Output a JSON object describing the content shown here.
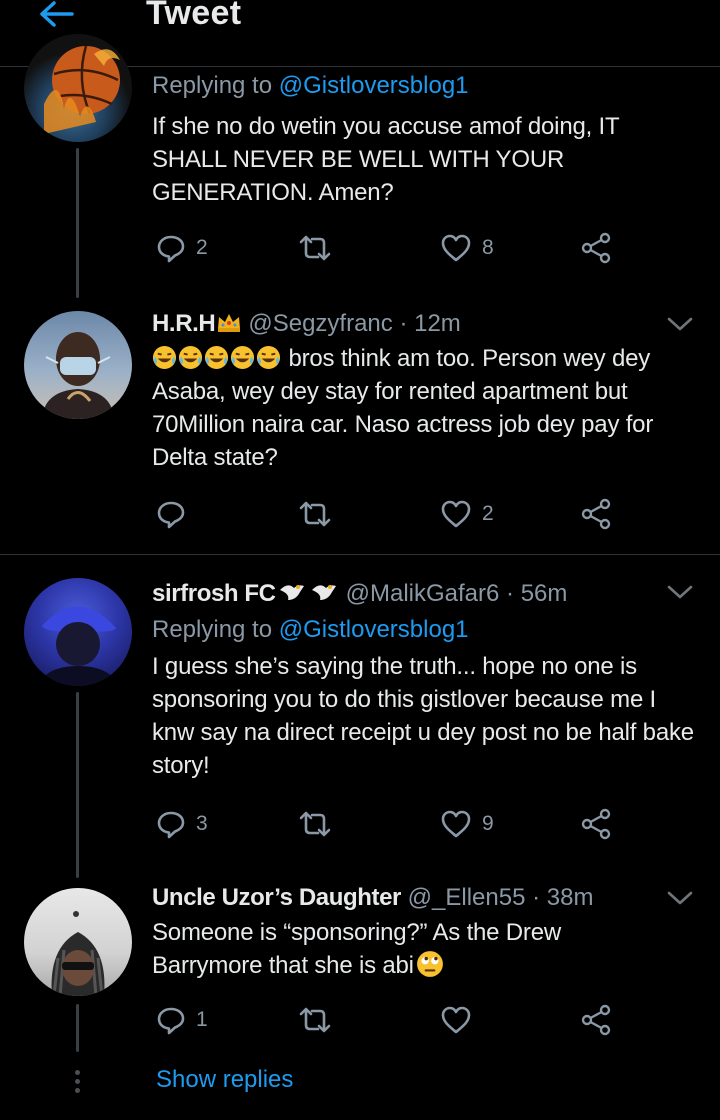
{
  "header": {
    "title": "Tweet"
  },
  "tweets": [
    {
      "replying_prefix": "Replying to ",
      "replying_to": "@Gistloversblog1",
      "text": "If she no do wetin you accuse amof doing, IT SHALL NEVER BE WELL WITH YOUR GENERATION. Amen?",
      "reply_count": "2",
      "retweet_count": "",
      "like_count": "8"
    },
    {
      "name": "H.R.H",
      "handle": "@Segzyfranc",
      "time": "· 12m",
      "text": "bros think am too. Person wey dey Asaba, wey dey stay for rented apartment but 70Million naira car. Naso actress job dey pay for Delta state?",
      "emoji_name": "tears-of-joy-emoji",
      "reply_count": "",
      "retweet_count": "",
      "like_count": "2"
    },
    {
      "name": "sirfrosh FC",
      "handle": "@MalikGafar6",
      "time": "· 56m",
      "replying_prefix": "Replying to ",
      "replying_to": "@Gistloversblog1",
      "text": "I guess she’s saying the truth... hope no one is sponsoring you to do this gistlover because me I knw say na direct receipt u dey post no be half bake story!",
      "reply_count": "3",
      "retweet_count": "",
      "like_count": "9"
    },
    {
      "name": "Uncle Uzor’s Daughter",
      "handle": "@_Ellen55",
      "time": "· 38m",
      "text_line1": "Someone is “sponsoring?” As the Drew",
      "text_line2": "Barrymore that she is abi",
      "reply_count": "1",
      "retweet_count": "",
      "like_count": ""
    }
  ],
  "show_replies": "Show replies",
  "colors": {
    "accent": "#1d9bf0",
    "background": "#000000",
    "text": "#e7e9ea",
    "muted": "#8b98a5",
    "divider": "#2f3336"
  }
}
